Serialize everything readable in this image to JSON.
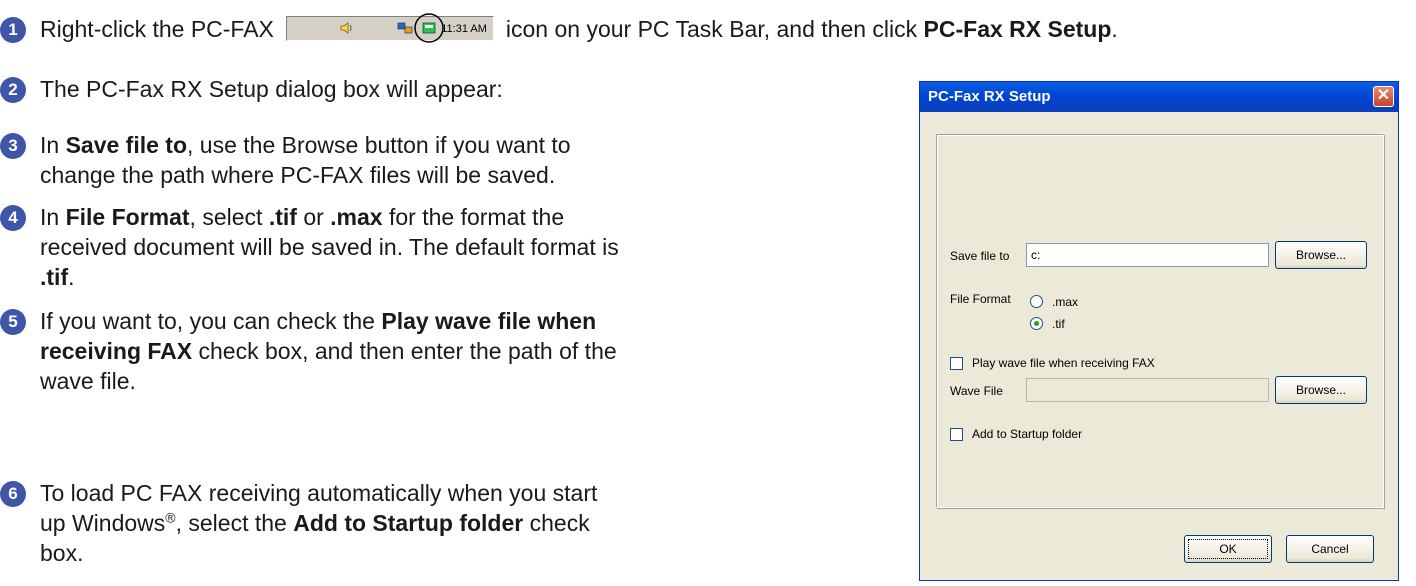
{
  "steps": [
    {
      "number": "1",
      "before": "Right-click the PC-FAX",
      "after": "icon on your PC Task Bar, and then click",
      "bold": "PC-Fax RX Setup",
      "end": "."
    },
    {
      "number": "2",
      "text": "The PC-Fax RX Setup dialog box will appear:"
    },
    {
      "number": "3",
      "t1": "In",
      "b1": "Save file to",
      "t2": ", use the Browse button if you want to",
      "line2": "change the path where PC-FAX files will be saved."
    },
    {
      "number": "4",
      "t1": "In",
      "b1": "File Format",
      "t2": ", select",
      "b2": ".tif",
      "t3": "or",
      "b3": ".max",
      "t4": "for the format the",
      "line2": "received document will be saved in. The default format is",
      "b4": ".tif",
      "end": "."
    },
    {
      "number": "5",
      "t1": "If you want to, you can check the",
      "b1": "Play wave file when",
      "b2": "receiving FAX",
      "t2": "check box, and then enter the path of the",
      "line3": "wave file."
    },
    {
      "number": "6",
      "line1": "To load PC FAX receiving automatically when you start",
      "t1": "up Windows",
      "sup": "®",
      "t2": ", select the",
      "b1": "Add to Startup folder",
      "t3": "check",
      "line3": "box."
    }
  ],
  "taskbar": {
    "clock": "11:31 AM",
    "icons": [
      "speaker-icon",
      "network-icon",
      "pc-fax-icon"
    ]
  },
  "dialog": {
    "title": "PC-Fax RX Setup",
    "close_symbol": "✕",
    "save_file_label": "Save file to",
    "save_file_value": "c:",
    "browse_label": "Browse...",
    "file_format_label": "File Format",
    "option_max": ".max",
    "option_tif": ".tif",
    "selected_format": ".tif",
    "play_wave_label": "Play wave file when receiving FAX",
    "play_wave_checked": false,
    "wave_file_label": "Wave File",
    "wave_file_value": "",
    "wave_browse_label": "Browse...",
    "add_startup_label": "Add to Startup folder",
    "add_startup_checked": false,
    "ok_label": "OK",
    "cancel_label": "Cancel"
  },
  "colors": {
    "step_badge": "#3f55a8",
    "titlebar": "#0046d5",
    "dialog_bg": "#ece9d8"
  }
}
